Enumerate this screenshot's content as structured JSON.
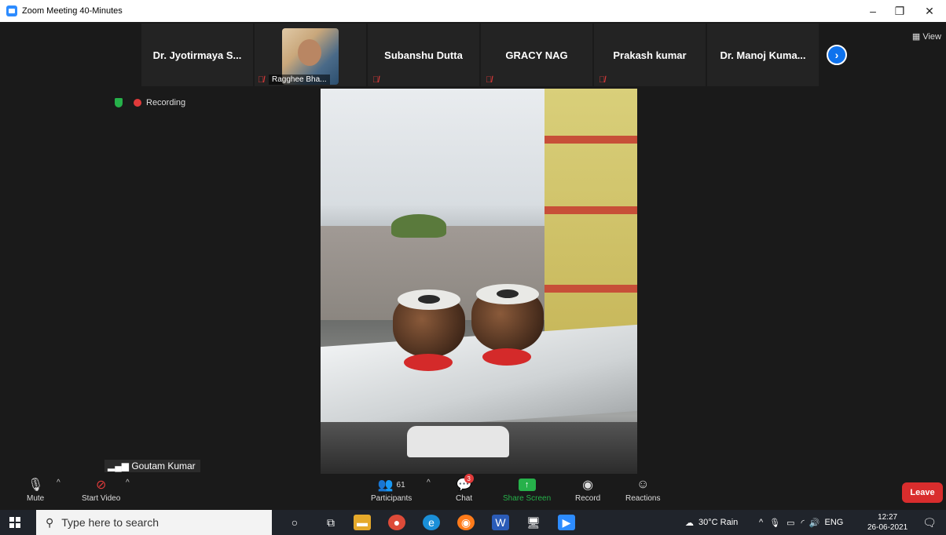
{
  "window": {
    "title": "Zoom Meeting 40-Minutes",
    "minimize": "–",
    "restore": "❐",
    "close": "✕"
  },
  "participants_strip": [
    {
      "name": "Dr. Jyotirmaya S...",
      "muted": false
    },
    {
      "name": "Ragghee Bha...",
      "muted": true,
      "has_video": true
    },
    {
      "name": "Subanshu Dutta",
      "muted": true
    },
    {
      "name": "GRACY NAG",
      "muted": true
    },
    {
      "name": "Prakash kumar",
      "muted": true
    },
    {
      "name": "Dr. Manoj Kuma...",
      "muted": false
    }
  ],
  "view_label": "View",
  "next_icon": "›",
  "recording_label": "Recording",
  "active_speaker": "Goutam Kumar",
  "toolbar": {
    "mute_label": "Mute",
    "start_video_label": "Start Video",
    "participants_label": "Participants",
    "participants_count": "61",
    "chat_label": "Chat",
    "chat_badge": "3",
    "share_screen_label": "Share Screen",
    "record_label": "Record",
    "reactions_label": "Reactions",
    "leave_label": "Leave"
  },
  "taskbar": {
    "search_placeholder": "Type here to search",
    "weather": "30°C  Rain",
    "language": "ENG",
    "time": "12:27",
    "date": "26-06-2021"
  },
  "colors": {
    "accent": "#0e72ed",
    "leave": "#d92d2d",
    "share": "#26b14a",
    "muted": "#e03a3a"
  }
}
